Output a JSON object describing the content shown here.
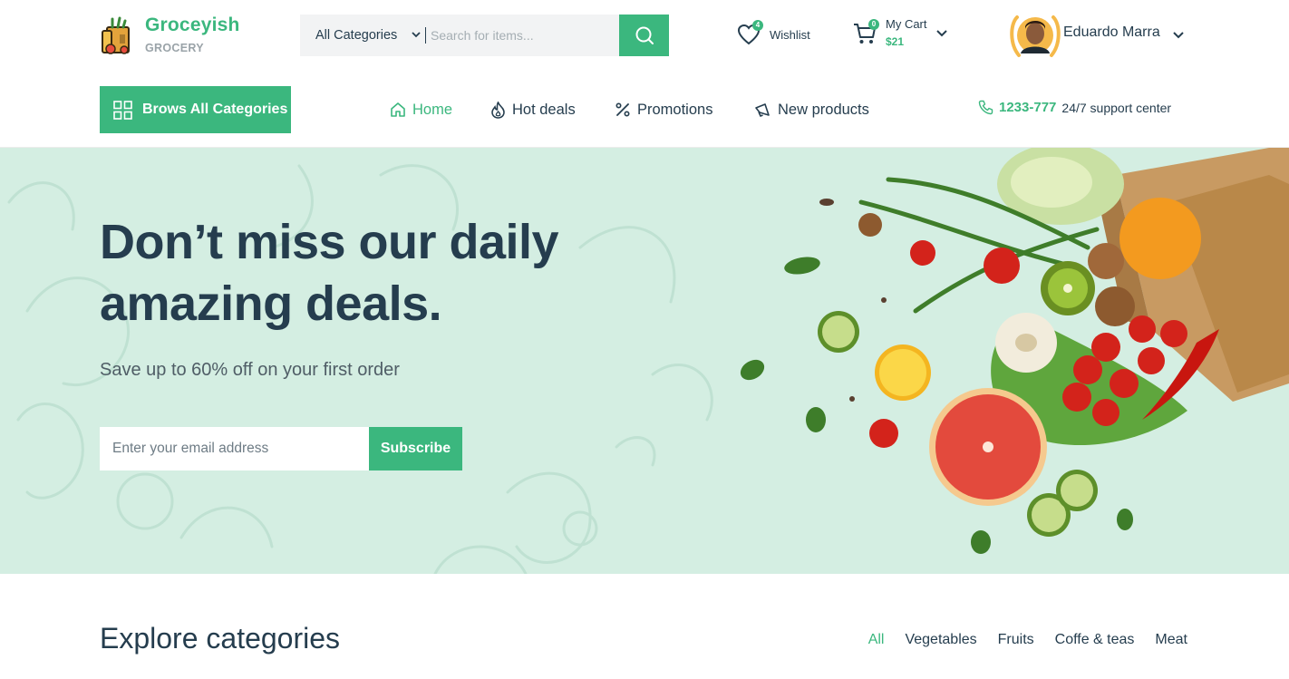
{
  "brand": {
    "name": "Groceyish",
    "tagline": "GROCERY",
    "logo_icon": "grocery-bag-icon",
    "accent_color": "#3bb77e",
    "heading_color": "#253d4e"
  },
  "search": {
    "category_selected": "All Categories",
    "placeholder": "Search for items...",
    "button_icon": "search-icon"
  },
  "header": {
    "wishlist": {
      "label": "Wishlist",
      "count": "4",
      "icon": "heart-icon"
    },
    "cart": {
      "label": "My Cart",
      "amount": "$21",
      "count": "0",
      "icon": "cart-icon"
    },
    "user": {
      "name": "Eduardo Marra",
      "icon": "avatar"
    }
  },
  "nav": {
    "browse_label": "Brows All Categories",
    "items": [
      {
        "label": "Home",
        "icon": "home-icon",
        "active": true
      },
      {
        "label": "Hot deals",
        "icon": "flame-icon",
        "active": false
      },
      {
        "label": "Promotions",
        "icon": "percent-icon",
        "active": false
      },
      {
        "label": "New products",
        "icon": "megaphone-icon",
        "active": false
      }
    ],
    "support": {
      "phone": "1233-777",
      "text": "24/7 support center",
      "icon": "phone-icon"
    }
  },
  "hero": {
    "title_line1": "Don’t miss our daily",
    "title_line2": "amazing deals.",
    "subtitle": "Save up to 60% off on your first order",
    "email_placeholder": "Enter your email address",
    "subscribe_label": "Subscribe",
    "background_color": "#d4eee2"
  },
  "explore": {
    "title": "Explore categories",
    "tabs": [
      {
        "label": "All",
        "active": true
      },
      {
        "label": "Vegetables",
        "active": false
      },
      {
        "label": "Fruits",
        "active": false
      },
      {
        "label": "Coffe & teas",
        "active": false
      },
      {
        "label": "Meat",
        "active": false
      }
    ]
  }
}
